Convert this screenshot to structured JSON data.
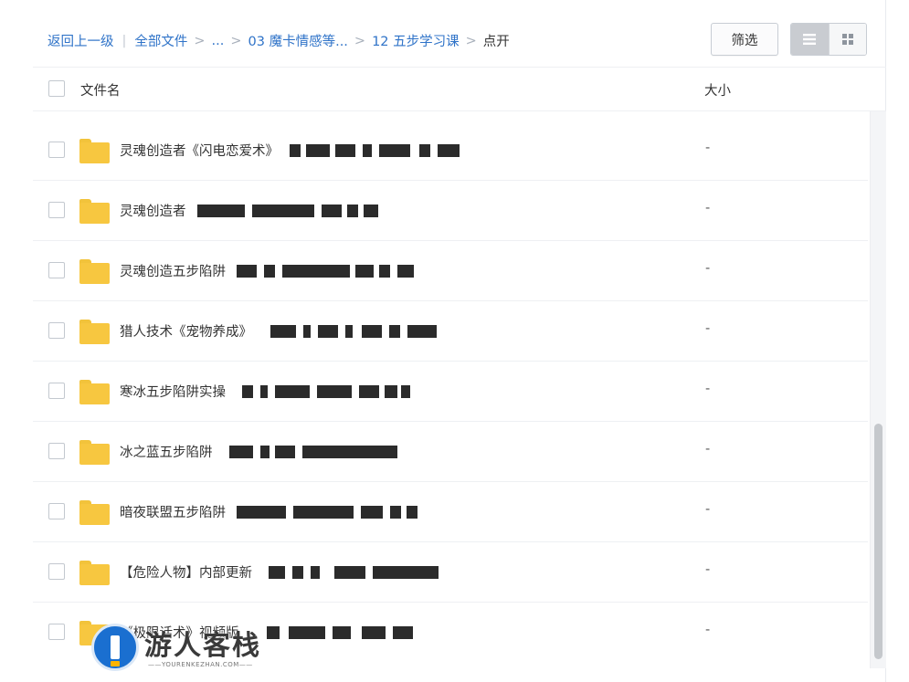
{
  "breadcrumb": {
    "back": "返回上一级",
    "all_files": "全部文件",
    "ellipsis": "...",
    "folder1": "03 魔卡情感等...",
    "folder2": "12 五步学习课",
    "current": "点开",
    "separator": ">",
    "pipe": "|"
  },
  "toolbar": {
    "filter_label": "筛选",
    "view_mode": "list"
  },
  "table": {
    "col_name": "文件名",
    "col_size": "大小",
    "rows": [
      {
        "name": "灵魂创造者《闪电恋爱术》",
        "size": "-"
      },
      {
        "name": "灵魂创造者",
        "size": "-"
      },
      {
        "name": "灵魂创造五步陷阱",
        "size": "-"
      },
      {
        "name": "猎人技术《宠物养成》",
        "size": "-"
      },
      {
        "name": "寒冰五步陷阱实操",
        "size": "-"
      },
      {
        "name": "冰之蓝五步陷阱",
        "size": "-"
      },
      {
        "name": "暗夜联盟五步陷阱",
        "size": "-"
      },
      {
        "name": "【危险人物】内部更新",
        "size": "-"
      },
      {
        "name": "《极限话术》视频版",
        "size": "-"
      }
    ]
  },
  "watermark": {
    "title": "游人客栈",
    "subtitle": "——YOURENKEZHAN.COM——"
  },
  "colors": {
    "link": "#2f73c8",
    "folder": "#f7c740"
  }
}
